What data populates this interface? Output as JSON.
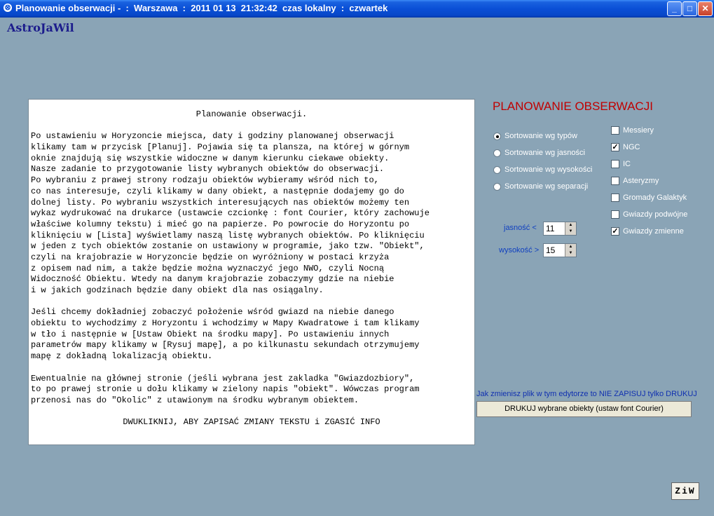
{
  "window": {
    "title": "Planowanie obserwacji -  :  Warszawa  :  2011 01 13  21:32:42  czas lokalny  :  czwartek",
    "icon": "app-icon",
    "controls": {
      "minimize": "_",
      "maximize": "□",
      "close": "✕"
    }
  },
  "brand": "AstroJaWil",
  "info_lines": [
    "Planowanie obserwacji.",
    "",
    "Po ustawieniu w Horyzoncie miejsca, daty i godziny planowanej obserwacji",
    "klikamy tam w przycisk [Planuj]. Pojawia się ta plansza, na której w górnym",
    "oknie znajdują się wszystkie widoczne w danym kierunku ciekawe obiekty.",
    "Nasze zadanie to przygotowanie listy wybranych obiektów do obserwacji.",
    "Po wybraniu z prawej strony rodzaju obiektów wybieramy wśród nich to,",
    "co nas interesuje, czyli klikamy w dany obiekt, a następnie dodajemy go do",
    "dolnej listy. Po wybraniu wszystkich interesujących nas obiektów możemy ten",
    "wykaz wydrukować na drukarce (ustawcie czcionkę : font Courier, który zachowuje",
    "właściwe kolumny tekstu) i mieć go na papierze. Po powrocie do Horyzontu po",
    "kliknięciu w [Lista] wyświetlamy naszą listę wybranych obiektów. Po kliknięciu",
    "w jeden z tych obiektów zostanie on ustawiony w programie, jako tzw. \"Obiekt\",",
    "czyli na krajobrazie w Horyzoncie będzie on wyróżniony w postaci krzyża",
    "z opisem nad nim, a także będzie można wyznaczyć jego NWO, czyli Nocną",
    "Widoczność Obiektu. Wtedy na danym krajobrazie zobaczymy gdzie na niebie",
    "i w jakich godzinach będzie dany obiekt dla nas osiągalny.",
    "",
    "Jeśli chcemy dokładniej zobaczyć położenie wśród gwiazd na niebie danego",
    "obiektu to wychodzimy z Horyzontu i wchodzimy w Mapy Kwadratowe i tam klikamy",
    "w tło i następnie w [Ustaw Obiekt na środku mapy]. Po ustawieniu innych",
    "parametrów mapy klikamy w [Rysuj mapę], a po kilkunastu sekundach otrzymujemy",
    "mapę z dokładną lokalizacją obiektu.",
    "",
    "Ewentualnie na głównej stronie (jeśli wybrana jest zakladka \"Gwiazdozbiory\",",
    "to po prawej stronie u dołu klikamy w zielony napis \"obiekt\". Wówczas program",
    "przenosi nas do \"Okolic\" z utawionym na środku wybranym obiektem.",
    "",
    "DWUKLIKNIJ, ABY ZAPISAĆ ZMIANY TEKSTU i ZGASIĆ INFO"
  ],
  "panel": {
    "heading": "PLANOWANIE OBSERWACJI",
    "sort_options": [
      {
        "label": "Sortowanie wg typów",
        "selected": true
      },
      {
        "label": "Sortowanie wg jasności",
        "selected": false
      },
      {
        "label": "Sortowanie wg wysokości",
        "selected": false
      },
      {
        "label": "Sortowanie wg separacji",
        "selected": false
      }
    ],
    "filters": [
      {
        "label": "Messiery",
        "checked": false
      },
      {
        "label": "NGC",
        "checked": true
      },
      {
        "label": "IC",
        "checked": false
      },
      {
        "label": "Asteryzmy",
        "checked": false
      },
      {
        "label": "Gromady Galaktyk",
        "checked": false
      },
      {
        "label": "Gwiazdy podwójne",
        "checked": false
      },
      {
        "label": "Gwiazdy zmienne",
        "checked": true
      }
    ],
    "brightness": {
      "label": "jasność <",
      "value": "11"
    },
    "altitude": {
      "label": "wysokość >",
      "value": "15"
    },
    "note": "Jak zmienisz plik w tym edytorze to NIE ZAPISUJ tylko DRUKUJ",
    "print_button": "DRUKUJ wybrane obiekty (ustaw font Courier)",
    "ziw_button": "ZiW"
  },
  "colors": {
    "background": "#8aa4b6",
    "heading": "#c00000",
    "note": "#1030b0",
    "brand": "#1c1c8c"
  }
}
